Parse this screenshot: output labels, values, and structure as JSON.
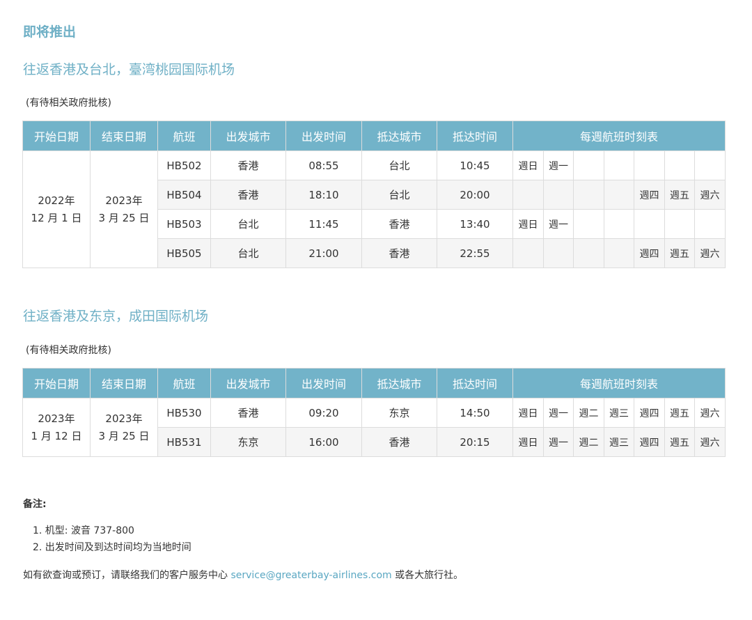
{
  "heading": "即将推出",
  "sections": [
    {
      "title": "往返香港及台北，臺湾桃园国际机场",
      "approval": "(有待相关政府批核)",
      "headers": [
        "开始日期",
        "结束日期",
        "航班",
        "出发城市",
        "出发时间",
        "抵达城市",
        "抵达时间",
        "每週航班时刻表"
      ],
      "start_date": [
        "2022年",
        "12 月 1 日"
      ],
      "end_date": [
        "2023年",
        "3 月 25 日"
      ],
      "rows": [
        {
          "flight": "HB502",
          "from": "香港",
          "dep": "08:55",
          "to": "台北",
          "arr": "10:45",
          "days": [
            "週日",
            "週一",
            "",
            "",
            "",
            "",
            ""
          ]
        },
        {
          "flight": "HB504",
          "from": "香港",
          "dep": "18:10",
          "to": "台北",
          "arr": "20:00",
          "days": [
            "",
            "",
            "",
            "",
            "週四",
            "週五",
            "週六"
          ]
        },
        {
          "flight": "HB503",
          "from": "台北",
          "dep": "11:45",
          "to": "香港",
          "arr": "13:40",
          "days": [
            "週日",
            "週一",
            "",
            "",
            "",
            "",
            ""
          ]
        },
        {
          "flight": "HB505",
          "from": "台北",
          "dep": "21:00",
          "to": "香港",
          "arr": "22:55",
          "days": [
            "",
            "",
            "",
            "",
            "週四",
            "週五",
            "週六"
          ]
        }
      ]
    },
    {
      "title": "往返香港及东京，成田国际机场",
      "approval": "(有待相关政府批核)",
      "headers": [
        "开始日期",
        "结束日期",
        "航班",
        "出发城市",
        "出发时间",
        "抵达城市",
        "抵达时间",
        "每週航班时刻表"
      ],
      "start_date": [
        "2023年",
        "1 月 12 日"
      ],
      "end_date": [
        "2023年",
        "3 月 25 日"
      ],
      "rows": [
        {
          "flight": "HB530",
          "from": "香港",
          "dep": "09:20",
          "to": "东京",
          "arr": "14:50",
          "days": [
            "週日",
            "週一",
            "週二",
            "週三",
            "週四",
            "週五",
            "週六"
          ]
        },
        {
          "flight": "HB531",
          "from": "东京",
          "dep": "16:00",
          "to": "香港",
          "arr": "20:15",
          "days": [
            "週日",
            "週一",
            "週二",
            "週三",
            "週四",
            "週五",
            "週六"
          ]
        }
      ]
    }
  ],
  "notes": {
    "title": "备注:",
    "items": [
      "1. 机型: 波音 737-800",
      "2. 出发时间及到达时间均为当地时间"
    ]
  },
  "contact": {
    "prefix": "如有欲查询或预订，请联络我们的客户服务中心 ",
    "email": "service@greaterbay-airlines.com",
    "suffix": " 或各大旅行社。"
  },
  "colors": {
    "accent": "#6fb0c6",
    "header_bg": "#72b3c9",
    "link": "#5aa7c2",
    "border": "#dcdcdc",
    "alt_row": "#f5f5f5"
  }
}
